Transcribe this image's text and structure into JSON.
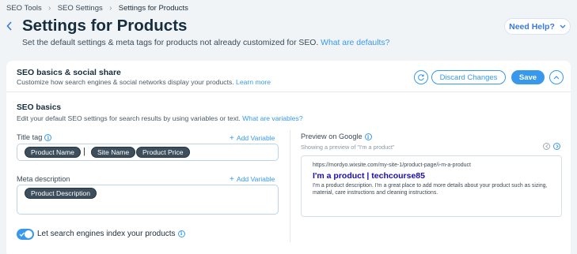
{
  "breadcrumb": {
    "items": [
      "SEO Tools",
      "SEO Settings",
      "Settings for Products"
    ],
    "separator": "›"
  },
  "header": {
    "back_icon": "chevron-left-icon",
    "title": "Settings for Products",
    "subtitle": "Set the default settings & meta tags for products not already customized for SEO.",
    "subtitle_link": "What are defaults?",
    "help_label": "Need Help?"
  },
  "card": {
    "title": "SEO basics & social share",
    "subtitle": "Customize how search engines & social networks display your products.",
    "subtitle_link": "Learn more",
    "discard_label": "Discard Changes",
    "save_label": "Save",
    "reset_icon": "reset-icon",
    "collapse_icon": "chevron-up-icon"
  },
  "seo_basics": {
    "title": "SEO basics",
    "subtitle": "Edit your default SEO settings for search results by using variables or text.",
    "subtitle_link": "What are variables?",
    "title_tag": {
      "label": "Title tag",
      "add_variable": "Add Variable",
      "chips": [
        "Product Name",
        "Site Name",
        "Product Price"
      ],
      "separator": "|"
    },
    "meta_description": {
      "label": "Meta description",
      "add_variable": "Add Variable",
      "chips": [
        "Product Description"
      ]
    },
    "index_toggle": {
      "label": "Let search engines index your products",
      "on": true
    }
  },
  "preview": {
    "label": "Preview on Google",
    "showing": "Showing a preview of \"I'm a product\"",
    "url": "https://mordyo.wixsite.com/my-site-1/product-page/i-m-a-product",
    "title": "I'm a product | techcourse85",
    "description": "I'm a product description. I'm a great place to add more details about your product such as sizing, material, care instructions and cleaning instructions."
  },
  "colors": {
    "accent": "#3899ec",
    "title_link": "#1a0dab",
    "chip_bg": "#3d4f5c",
    "page_bg": "#f0f4f7"
  }
}
